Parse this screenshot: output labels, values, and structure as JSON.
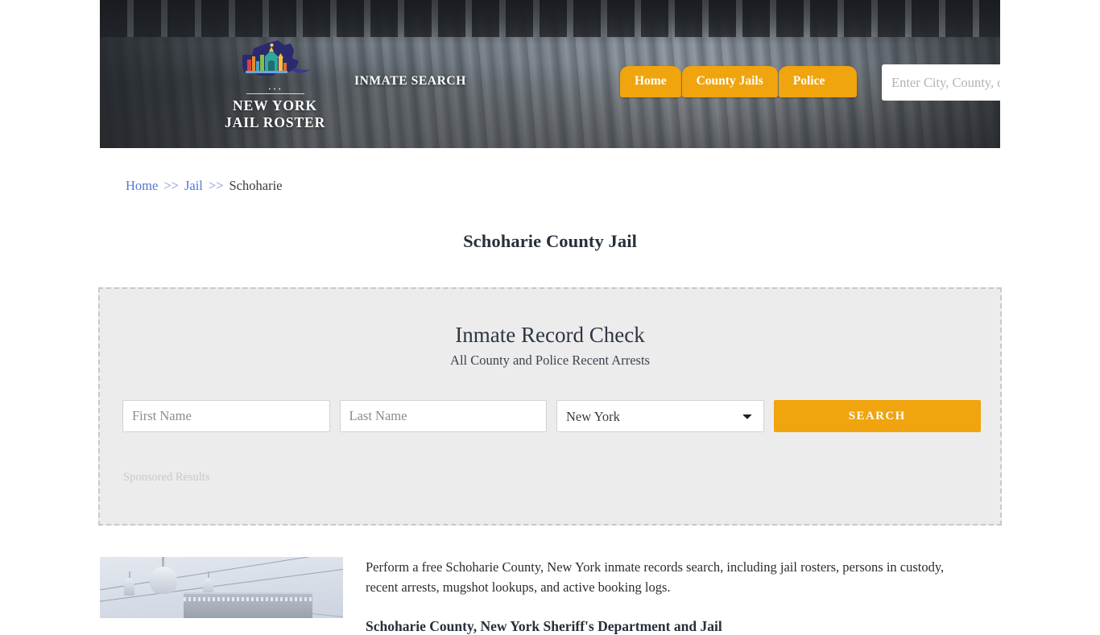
{
  "header": {
    "logo": {
      "line1": "NEW YORK",
      "line2": "JAIL ROSTER",
      "icon": "new-york-state-logo"
    },
    "tagline": "INMATE SEARCH",
    "nav": [
      {
        "label": "Home"
      },
      {
        "label": "County Jails"
      },
      {
        "label": "Police"
      }
    ],
    "search": {
      "placeholder": "Enter City, County, or Facil",
      "value": "",
      "button_icon": "search-icon"
    },
    "accent_color": "#F0A40D"
  },
  "breadcrumb": {
    "home": "Home",
    "sep1": ">>",
    "jail": "Jail",
    "sep2": ">>",
    "current": "Schoharie"
  },
  "page": {
    "title": "Schoharie County Jail"
  },
  "record_check": {
    "title": "Inmate Record Check",
    "subtitle": "All County and Police Recent Arrests",
    "first_name_placeholder": "First Name",
    "first_name_value": "",
    "last_name_placeholder": "Last Name",
    "last_name_value": "",
    "state_selected": "New York",
    "state_options": [
      "New York"
    ],
    "search_button": "SEARCH",
    "sponsored_label": "Sponsored Results"
  },
  "content": {
    "image_alt": "schoharie-county-courthouse-photo",
    "paragraph": "Perform a free Schoharie County, New York inmate records search, including jail rosters, persons in custody, recent arrests, mugshot lookups, and active booking logs.",
    "heading": "Schoharie County, New York Sheriff's Department and Jail"
  }
}
